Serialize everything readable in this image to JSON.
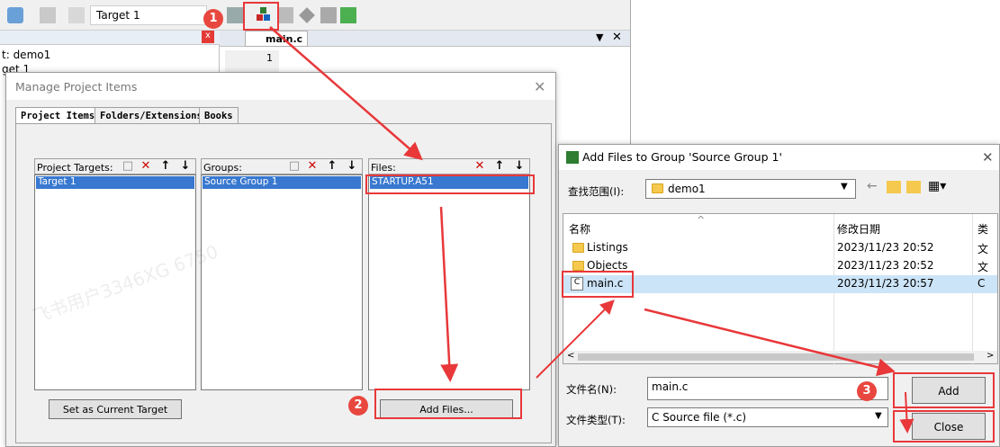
{
  "toolbar": {
    "target": "Target 1"
  },
  "project_pane": {
    "line1": "t: demo1",
    "line2": "get 1"
  },
  "editor": {
    "tab": "main.c",
    "line_number": "1"
  },
  "manage_dialog": {
    "title": "Manage Project Items",
    "tabs": [
      "Project Items",
      "Folders/Extensions",
      "Books"
    ],
    "targets": {
      "header": "Project Targets:",
      "items": [
        "Target 1"
      ]
    },
    "groups": {
      "header": "Groups:",
      "items": [
        "Source Group 1"
      ]
    },
    "files": {
      "header": "Files:",
      "items": [
        "STARTUP.A51"
      ]
    },
    "set_current_label": "Set as Current Target",
    "add_files_label": "Add Files..."
  },
  "add_dialog": {
    "title": "Add Files to Group 'Source Group 1'",
    "lookin_label": "查找范围(I):",
    "lookin_value": "demo1",
    "col_name": "名称",
    "col_date": "修改日期",
    "col_type": "类",
    "rows": [
      {
        "name": "Listings",
        "date": "2023/11/23 20:52",
        "type": "文"
      },
      {
        "name": "Objects",
        "date": "2023/11/23 20:52",
        "type": "文"
      },
      {
        "name": "main.c",
        "date": "2023/11/23 20:57",
        "type": "C"
      }
    ],
    "filename_label": "文件名(N):",
    "filename_value": "main.c",
    "filetype_label": "文件类型(T):",
    "filetype_value": "C Source file (*.c)",
    "add_label": "Add",
    "close_label": "Close"
  },
  "annotations": [
    "1",
    "2",
    "3"
  ],
  "watermark": "飞书用户3346XG 6750",
  "colors": {
    "annotation": "#e8383a",
    "selection": "#3878d0"
  }
}
